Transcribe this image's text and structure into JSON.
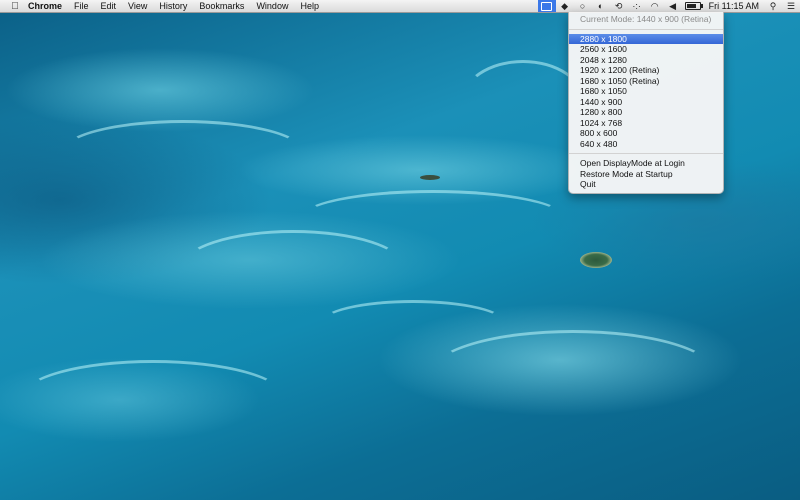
{
  "menubar": {
    "apple_icon": "apple-logo-icon",
    "app_name": "Chrome",
    "items": [
      "File",
      "Edit",
      "View",
      "History",
      "Bookmarks",
      "Window",
      "Help"
    ],
    "clock": "Fri 11:15 AM"
  },
  "status_icons": [
    {
      "name": "displaymode-icon",
      "glyph": "▣"
    },
    {
      "name": "dropbox-icon",
      "glyph": "◆"
    },
    {
      "name": "chat-bubble-icon",
      "glyph": "○"
    },
    {
      "name": "sync-icon",
      "glyph": "◐"
    },
    {
      "name": "time-machine-icon",
      "glyph": "⟲"
    },
    {
      "name": "bluetooth-dots-icon",
      "glyph": "·:·"
    },
    {
      "name": "wifi-icon",
      "glyph": "◠"
    },
    {
      "name": "volume-icon",
      "glyph": "◀"
    },
    {
      "name": "battery-icon",
      "glyph": ""
    },
    {
      "name": "spotlight-search-icon",
      "glyph": "⚲"
    },
    {
      "name": "notification-center-icon",
      "glyph": "☰"
    }
  ],
  "dropdown": {
    "current_mode": "Current Mode: 1440 x 900 (Retina)",
    "resolutions": [
      "2880 x 1800",
      "2560 x 1600",
      "2048 x 1280",
      "1920 x 1200 (Retina)",
      "1680 x 1050 (Retina)",
      "1680 x 1050",
      "1440 x 900",
      "1280 x 800",
      "1024 x 768",
      "800 x 600",
      "640 x 480"
    ],
    "selected_index": 0,
    "actions": [
      "Open DisplayMode at Login",
      "Restore Mode at Startup",
      "Quit"
    ]
  },
  "colors": {
    "highlight": "#3b78e8",
    "menubar": "#e6e6e6",
    "wallpaper": "#128bb2"
  }
}
